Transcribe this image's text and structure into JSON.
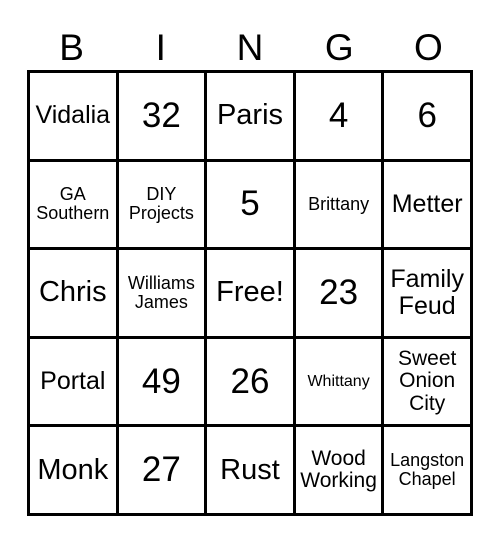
{
  "card": {
    "title": "Bingo Card",
    "columns": [
      "B",
      "I",
      "N",
      "G",
      "O"
    ],
    "rows": [
      [
        {
          "text": "Vidalia",
          "size": "sz-md"
        },
        {
          "text": "32",
          "size": "sz-xl"
        },
        {
          "text": "Paris",
          "size": "sz-lg"
        },
        {
          "text": "4",
          "size": "sz-xl"
        },
        {
          "text": "6",
          "size": "sz-xl"
        }
      ],
      [
        {
          "text": "GA\nSouthern",
          "size": "sz-xs"
        },
        {
          "text": "DIY\nProjects",
          "size": "sz-xs"
        },
        {
          "text": "5",
          "size": "sz-xl"
        },
        {
          "text": "Brittany",
          "size": "sz-xs"
        },
        {
          "text": "Metter",
          "size": "sz-md"
        }
      ],
      [
        {
          "text": "Chris",
          "size": "sz-lg"
        },
        {
          "text": "Williams\nJames",
          "size": "sz-xs"
        },
        {
          "text": "Free!",
          "size": "sz-lg"
        },
        {
          "text": "23",
          "size": "sz-xl"
        },
        {
          "text": "Family\nFeud",
          "size": "sz-md"
        }
      ],
      [
        {
          "text": "Portal",
          "size": "sz-md"
        },
        {
          "text": "49",
          "size": "sz-xl"
        },
        {
          "text": "26",
          "size": "sz-xl"
        },
        {
          "text": "Whittany",
          "size": "sz-xxs"
        },
        {
          "text": "Sweet\nOnion\nCity",
          "size": "sz-sm"
        }
      ],
      [
        {
          "text": "Monk",
          "size": "sz-lg"
        },
        {
          "text": "27",
          "size": "sz-xl"
        },
        {
          "text": "Rust",
          "size": "sz-lg"
        },
        {
          "text": "Wood\nWorking",
          "size": "sz-sm"
        },
        {
          "text": "Langston\nChapel",
          "size": "sz-xs"
        }
      ]
    ],
    "free_space": {
      "row": 2,
      "col": 2,
      "label": "Free!"
    },
    "colors": {
      "background": "#ffffff",
      "border": "#000000",
      "text": "#000000"
    }
  }
}
